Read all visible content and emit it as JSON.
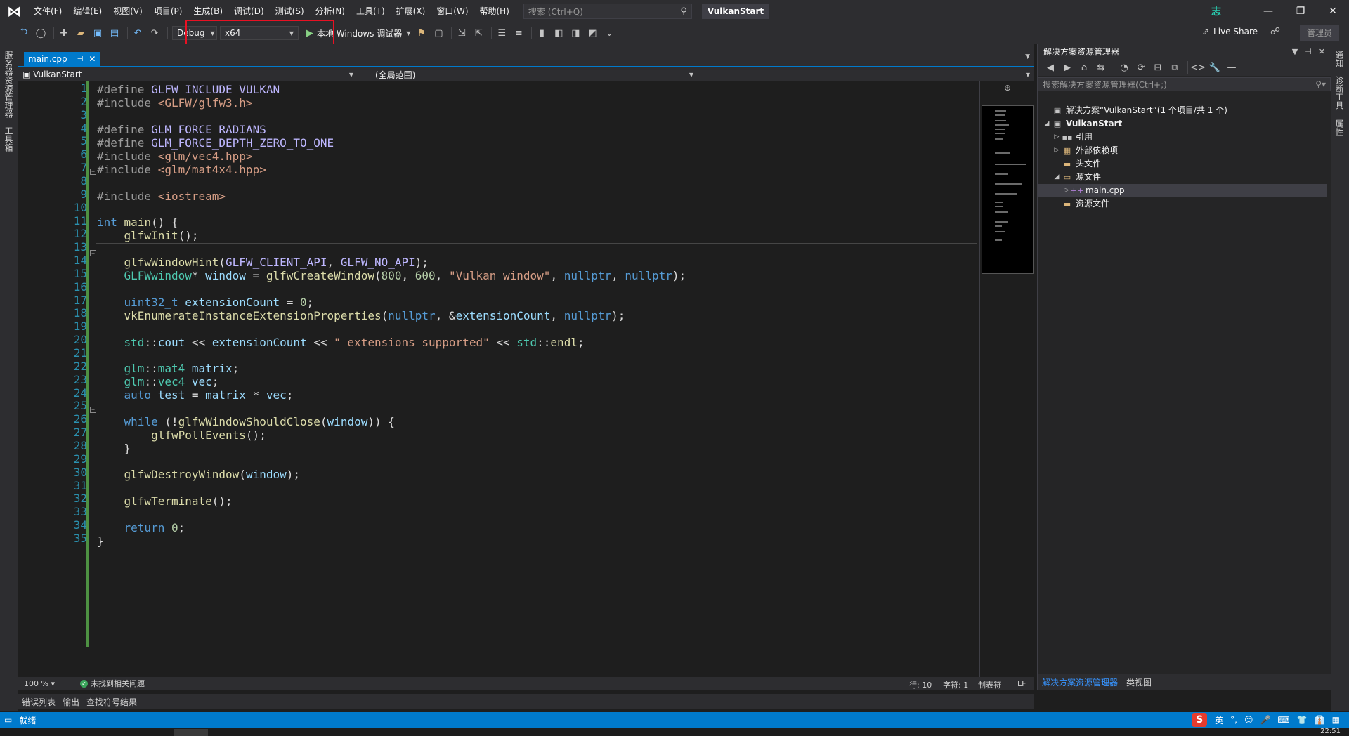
{
  "menubar": {
    "items": [
      "文件(F)",
      "编辑(E)",
      "视图(V)",
      "项目(P)",
      "生成(B)",
      "调试(D)",
      "测试(S)",
      "分析(N)",
      "工具(T)",
      "扩展(X)",
      "窗口(W)",
      "帮助(H)"
    ],
    "search_placeholder": "搜索 (Ctrl+Q)",
    "solution_name": "VulkanStart",
    "account_initial": "志"
  },
  "toolbar": {
    "config": "Debug",
    "platform": "x64",
    "run_target": "本地 Windows 调试器",
    "live_share": "Live Share",
    "admin": "管理员"
  },
  "left_strip": {
    "tabs": [
      "服务器资源管理器",
      "工具箱"
    ]
  },
  "right_strip": {
    "tabs": [
      "通知",
      "诊断工具",
      "属性"
    ]
  },
  "editor": {
    "tab_label": "main.cpp",
    "nav_project": "VulkanStart",
    "nav_scope": "(全局范围)",
    "line_numbers": [
      "1",
      "2",
      "3",
      "4",
      "5",
      "6",
      "7",
      "8",
      "9",
      "10",
      "11",
      "12",
      "13",
      "14",
      "15",
      "16",
      "17",
      "18",
      "19",
      "20",
      "21",
      "22",
      "23",
      "24",
      "25",
      "26",
      "27",
      "28",
      "29",
      "30",
      "31",
      "32",
      "33",
      "34",
      "35"
    ],
    "zoom": "100 %",
    "issues": "未找到相关问题",
    "line": "行: 10",
    "char": "字符: 1",
    "tabs_mode": "制表符",
    "eol": "LF"
  },
  "bottom_tabs": [
    "错误列表",
    "输出",
    "查找符号结果"
  ],
  "solution_explorer": {
    "title": "解决方案资源管理器",
    "search_placeholder": "搜索解决方案资源管理器(Ctrl+;)",
    "tree": [
      {
        "label": "解决方案“VulkanStart”(1 个项目/共 1 个)",
        "icon": "solution-icon"
      },
      {
        "label": "VulkanStart",
        "icon": "project-icon"
      },
      {
        "label": "引用",
        "icon": "references-icon"
      },
      {
        "label": "外部依赖项",
        "icon": "external-deps-icon"
      },
      {
        "label": "头文件",
        "icon": "folder-icon"
      },
      {
        "label": "源文件",
        "icon": "folder-open-icon"
      },
      {
        "label": "main.cpp",
        "icon": "cpp-file-icon"
      },
      {
        "label": "资源文件",
        "icon": "folder-icon"
      }
    ],
    "bottom_tabs": [
      "解决方案资源管理器",
      "类视图"
    ]
  },
  "statusbar": {
    "status": "就绪",
    "ime_lang": "英",
    "clock_partial": "22:51"
  },
  "colors": {
    "accent": "#007acc",
    "highlight_box": "#e81123",
    "change_bar": "#57a64a"
  }
}
